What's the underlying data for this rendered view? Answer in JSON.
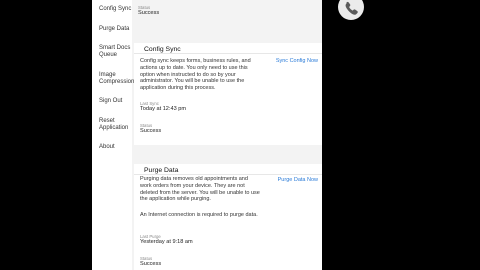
{
  "nav": {
    "items": [
      {
        "label": "Config Sync"
      },
      {
        "label": "Purge Data"
      },
      {
        "label": "Smart Docs Queue"
      },
      {
        "label": "Image Compression"
      },
      {
        "label": "Sign Out"
      },
      {
        "label": "Reset Application"
      },
      {
        "label": "About"
      }
    ]
  },
  "top": {
    "status_label": "Status",
    "status_value": "Success"
  },
  "config_sync": {
    "title": "Config Sync",
    "action": "Sync Config Now",
    "description": "Config sync keeps forms, business rules, and actions up to date. You only need to use this option when instructed to do so by your administrator. You will be unable to use the application during this process.",
    "last_sync_label": "Last Sync",
    "last_sync_value": "Today at 12:43 pm",
    "status_label": "Status",
    "status_value": "Success"
  },
  "purge_data": {
    "title": "Purge Data",
    "action": "Purge Data Now",
    "description": "Purging data removes old appointments and work orders from your device. They are not deleted from the server. You will be unable to use the application while purging.",
    "note": "An Internet connection is required to purge data.",
    "last_purge_label": "Last Purge",
    "last_purge_value": "Yesterday at 9:18 am",
    "status_label": "Status",
    "status_value": "Success"
  },
  "overlay": {
    "icon": "phone-icon"
  }
}
